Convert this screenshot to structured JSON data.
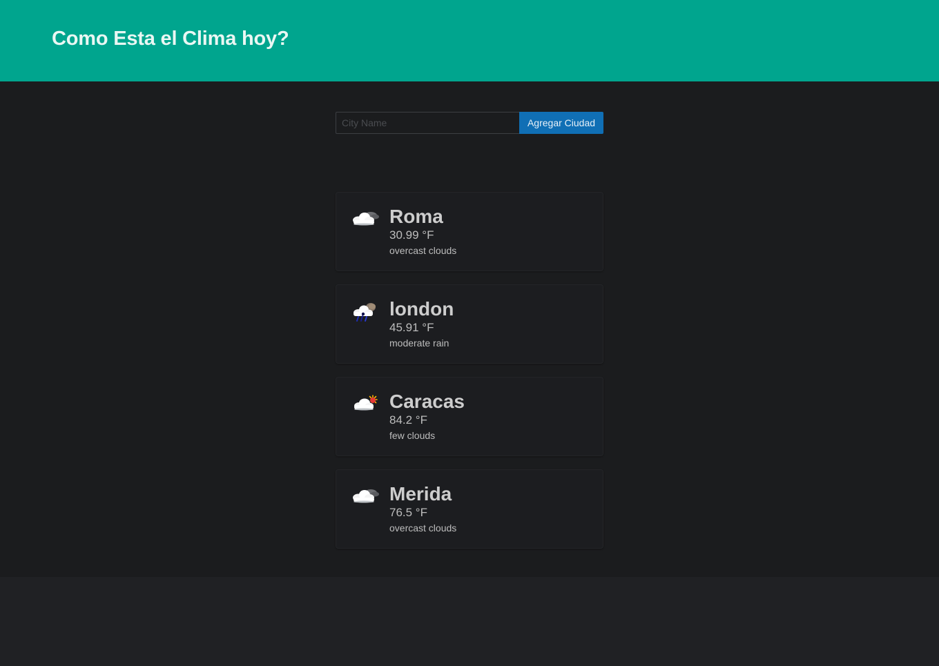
{
  "header": {
    "title": "Como Esta el Clima hoy?"
  },
  "search": {
    "placeholder": "City Name",
    "value": "",
    "button_label": "Agregar Ciudad"
  },
  "cities": [
    {
      "name": "Roma",
      "temperature": "30.99 °F",
      "description": "overcast clouds",
      "icon": "overcast-clouds-icon"
    },
    {
      "name": "london",
      "temperature": "45.91 °F",
      "description": "moderate rain",
      "icon": "rain-icon"
    },
    {
      "name": "Caracas",
      "temperature": "84.2 °F",
      "description": "few clouds",
      "icon": "few-clouds-icon"
    },
    {
      "name": "Merida",
      "temperature": "76.5 °F",
      "description": "overcast clouds",
      "icon": "overcast-clouds-icon"
    }
  ],
  "colors": {
    "header_bg": "#00a58e",
    "button_bg": "#106fb5",
    "page_bg": "#1b1c1e"
  }
}
